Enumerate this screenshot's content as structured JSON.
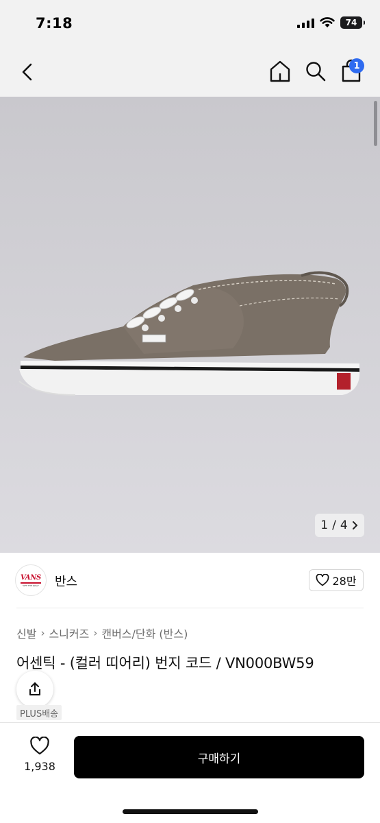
{
  "status_bar": {
    "time": "7:18",
    "battery": "74"
  },
  "nav": {
    "cart_badge": "1"
  },
  "gallery": {
    "current": "1",
    "separator": "/",
    "total": "4"
  },
  "brand": {
    "logo_text": "VANS",
    "logo_subtext": "\"OFF THE WALL\"",
    "name": "반스",
    "likes": "28만"
  },
  "breadcrumb": [
    "신발",
    "스니커즈",
    "캔버스/단화 (반스)"
  ],
  "product": {
    "title": "어센틱 - (컬러 띠어리) 번지 코드 / VN000BW59",
    "delivery_tag": "PLUS배송"
  },
  "bottom_bar": {
    "wish_count": "1,938",
    "buy_label": "구매하기"
  },
  "colors": {
    "badge": "#2f6bf0",
    "buy_button": "#000000",
    "hero_bg": "#d3d2d7",
    "shoe_upper": "#7a7066"
  },
  "icons": [
    "back-icon",
    "home-icon",
    "search-icon",
    "cart-icon",
    "share-icon",
    "heart-icon",
    "chevron-right-icon"
  ]
}
